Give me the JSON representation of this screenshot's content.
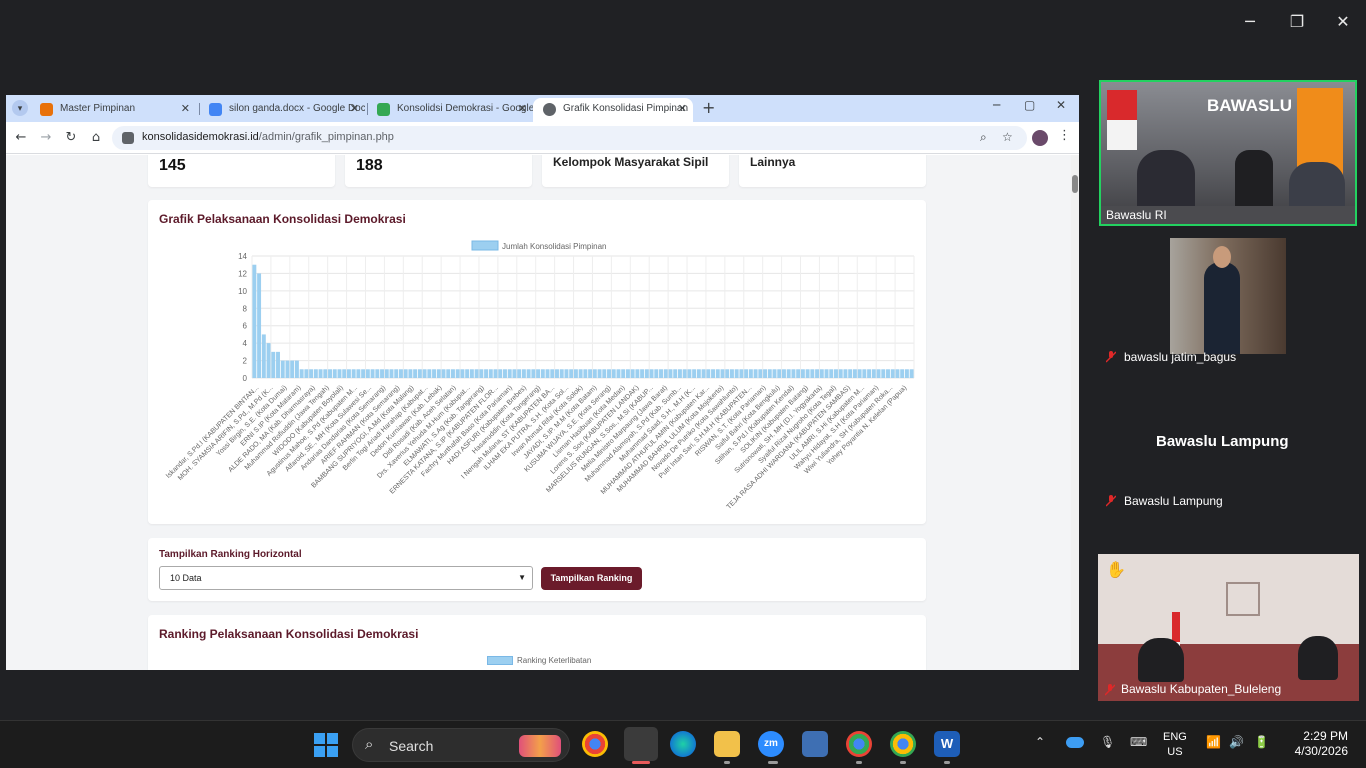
{
  "browser": {
    "tabs": [
      {
        "label": "Master Pimpinan",
        "icon": "app-logo-icon",
        "color": "#e8710a"
      },
      {
        "label": "silon ganda.docx - Google Docs",
        "icon": "docs-icon",
        "color": "#4285f4"
      },
      {
        "label": "Konsolidsi Demokrasi - Google",
        "icon": "drive-icon",
        "color": "#34a853"
      },
      {
        "label": "Grafik Konsolidasi Pimpinan",
        "icon": "globe-icon",
        "color": "#5f6368"
      }
    ],
    "url_domain": "konsolidasidemokrasi.id",
    "url_path": "/admin/grafik_pimpinan.php"
  },
  "stats": [
    {
      "value": "145"
    },
    {
      "value": "188"
    },
    {
      "label": "Kelompok Masyarakat Sipil"
    },
    {
      "label": "Lainnya"
    }
  ],
  "chart_card": {
    "title": "Grafik Pelaksanaan Konsolidasi Demokrasi"
  },
  "chart_data": {
    "type": "bar",
    "legend": "Jumlah Konsolidasi Pimpinan",
    "series_color": "#9ccff0",
    "ylim": [
      0,
      14
    ],
    "yticks": [
      0,
      2,
      4,
      6,
      8,
      10,
      12,
      14
    ],
    "values": [
      13,
      12,
      5,
      4,
      3,
      3,
      2,
      2,
      2,
      2,
      1,
      1,
      1,
      1,
      1,
      1,
      1,
      1,
      1,
      1,
      1,
      1,
      1,
      1,
      1,
      1,
      1,
      1,
      1,
      1,
      1,
      1,
      1,
      1,
      1,
      1,
      1,
      1,
      1,
      1,
      1,
      1,
      1,
      1,
      1,
      1,
      1,
      1,
      1,
      1,
      1,
      1,
      1,
      1,
      1,
      1,
      1,
      1,
      1,
      1,
      1,
      1,
      1,
      1,
      1,
      1,
      1,
      1,
      1,
      1,
      1,
      1,
      1,
      1,
      1,
      1,
      1,
      1,
      1,
      1,
      1,
      1,
      1,
      1,
      1,
      1,
      1,
      1,
      1,
      1,
      1,
      1,
      1,
      1,
      1,
      1,
      1,
      1,
      1,
      1,
      1,
      1,
      1,
      1,
      1,
      1,
      1,
      1,
      1,
      1,
      1,
      1,
      1,
      1,
      1,
      1,
      1,
      1,
      1,
      1,
      1,
      1,
      1,
      1,
      1,
      1,
      1,
      1,
      1,
      1,
      1,
      1,
      1,
      1,
      1,
      1,
      1,
      1,
      1,
      1
    ],
    "categories": [
      "Iskandar, S.Pd.I (KABUPATEN BINTAN...",
      "MOH. SYAMSIA ARIFIN, S.Pd., M.Pd (K...",
      "Yossi Birgin, S.E. (Kota Dumai)",
      "ERNI S.IP (Kota Mataram)",
      "ALDE RADO, MA (Kab. Dharmasraya)",
      "Muhammad Rofiuddin (Jawa Tengah)",
      "WIDODO (Kabupaten Boyolali)",
      "Agustinus Mahoe, S.Pd (Kabupaten M...",
      "Alfaroid, SE., MH (Kota Sulawesi Se...",
      "Andarias Dandarias (Kota Semarang)",
      "ARIEF RAHMAN (Kota Semarang)",
      "BAMBANG SUPRIYOGI, A.Md (Kota Malang)",
      "Berlin Togi Ariadi Harahap (Kabupat...",
      "Dedon Kurniawan (Kab. Lebak)",
      "Didi Rosadi (Kab. Aceh Selatan)",
      "Drs. Xaverius Yehuda M.Hum (Kabupat...",
      "ELMAWATI, S.Ag (Kab. Tangerang)",
      "ERNESTA KATANA, S.IP (KABUPATEN FLOR...",
      "Fachry Murthafah Baso (Kota Pariaman)",
      "HADI ASFURI (Kabupaten Brebes)",
      "Hasanuddin (Kota Tangerang)",
      "I Nengah Mulana, ST (KABUPATEN BA...",
      "ILHAM EKA PUTRA, S.H. (Kota Sol...",
      "Irwan Ahmad Rifai (Kota Solok)",
      "JAYADI, S.IP. M.M (Kota Batam)",
      "KUSUMA WIJAYA, S.E. (Kota Serang)",
      "Lisman Hasibuan (Kota Medan)",
      "Lorens S. Sos (KABUPATEN LANDAK)",
      "MARSELIUS RUNGAN, S.Sos., M.Si (KABUP...",
      "Melia Ministro Marpaung (Jawa Barat)",
      "Muhammad Alamsyah, S.Pd (Kab. Sumb...",
      "Muhammad Saad, S.H., M.H (K...",
      "MUHAMMAD ATHUFUL AMIN (Kabupaten Kar...",
      "MUHAMMAD BAHRUL ULUM (Kota Mojokerto)",
      "Novado De Putriko (Kota Sawahlunto)",
      "Putri Intan Sari, S.H.M.H (KABUPATEN...",
      "RISWAN, S.T. (Kota Pariaman)",
      "Saiful Bahri (Kota Bengkulu)",
      "Silihan, S.Pd.I (Kabupaten Kendal)",
      "SOLIKIN (Kabupaten Batang)",
      "Sutrisnowati, SH. MH (D.I. Yogyakarta)",
      "Syaiful Rizal Nugroho (Kota Tegal)",
      "TEJA RASA ADHI WARDANA (KABUPATEN SAMBAS)",
      "ULIL AMRI, S.Hi (Kabupaten M...",
      "Wahyu Hidayat, S.H (Kota Pariaman)",
      "Wiwi Yuliandra, SH (Kabupaten Roka...",
      "Yohey Poyantia N. Kelelan (Papua)"
    ]
  },
  "ranking_form": {
    "title": "Tampilkan Ranking Horizontal",
    "select_value": "10 Data",
    "button_label": "Tampilkan Ranking"
  },
  "ranking_card": {
    "title": "Ranking Pelaksanaan Konsolidasi Demokrasi",
    "legend": "Ranking Keterlibatan"
  },
  "zoom": {
    "participants": [
      {
        "name": "Bawaslu RI"
      },
      {
        "name": "bawaslu jatim_bagus"
      },
      {
        "name": "Bawaslu Lampung",
        "banner": "Bawaslu Lampung"
      },
      {
        "name": "Bawaslu Kabupaten_Buleleng"
      }
    ],
    "logo_text": "BAWASLU"
  },
  "taskbar": {
    "search_label": "Search",
    "lang_top": "ENG",
    "lang_bottom": "US",
    "time": "2:29 PM",
    "date": "4/30/2026"
  }
}
